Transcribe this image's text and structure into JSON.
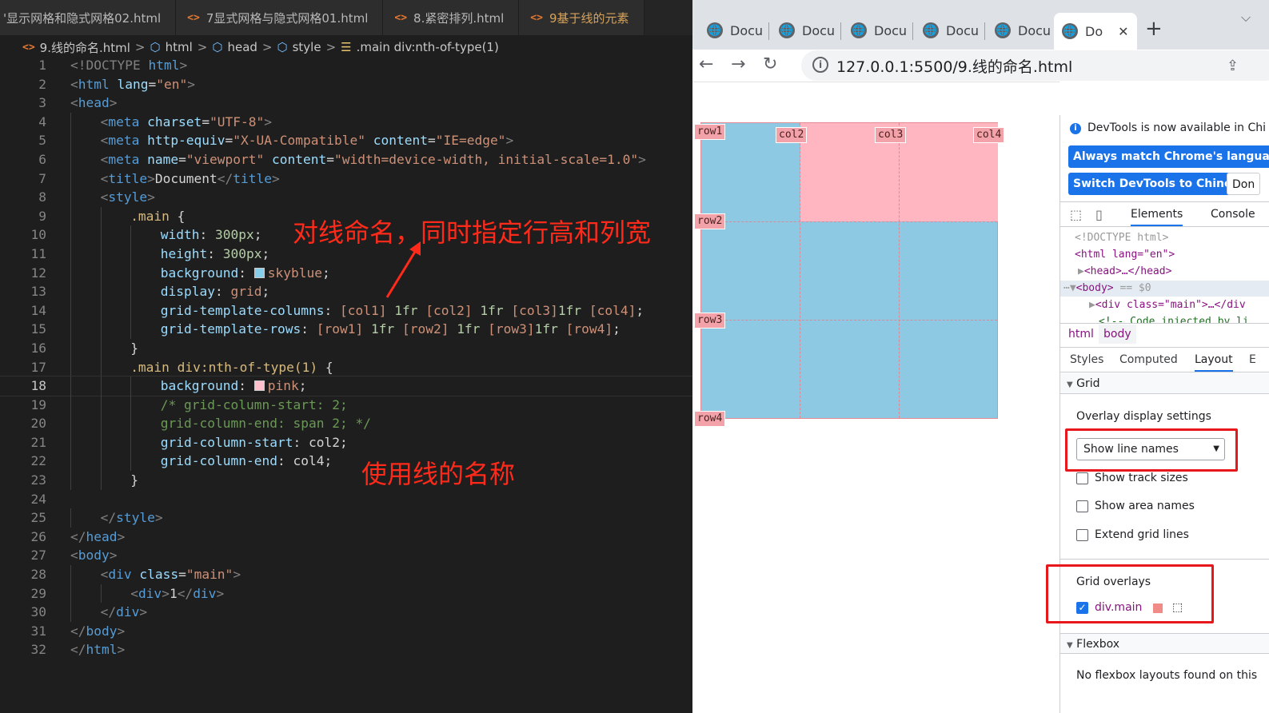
{
  "editor": {
    "tabs": [
      {
        "label": "'显示网格和隐式网格02.html",
        "icon": ""
      },
      {
        "label": "7显式网格与隐式网格01.html",
        "icon": "<>"
      },
      {
        "label": "8.紧密排列.html",
        "icon": "<>"
      },
      {
        "label": "9基于线的元素",
        "icon": "<>"
      }
    ],
    "breadcrumb": {
      "file": "9.线的命名.html",
      "html": "html",
      "head": "head",
      "style": "style",
      "selector": ".main div:nth-of-type(1)"
    },
    "code": {
      "l1": [
        "<!DOCTYPE ",
        "html",
        ">"
      ],
      "l2": [
        "<",
        "html",
        " ",
        "lang",
        "=",
        "\"en\"",
        ">"
      ],
      "l3": [
        "<",
        "head",
        ">"
      ],
      "l4": [
        "<",
        "meta",
        " ",
        "charset",
        "=",
        "\"UTF-8\"",
        ">"
      ],
      "l5": [
        "<",
        "meta",
        " ",
        "http-equiv",
        "=",
        "\"X-UA-Compatible\"",
        " ",
        "content",
        "=",
        "\"IE=edge\"",
        ">"
      ],
      "l6": [
        "<",
        "meta",
        " ",
        "name",
        "=",
        "\"viewport\"",
        " ",
        "content",
        "=",
        "\"width=device-width, initial-scale=1.0\"",
        ">"
      ],
      "l7": [
        "<",
        "title",
        ">",
        "Document",
        "</",
        "title",
        ">"
      ],
      "l8": [
        "<",
        "style",
        ">"
      ],
      "l9": [
        ".main",
        " {"
      ],
      "l10": [
        "width",
        ": ",
        "300px",
        ";"
      ],
      "l11": [
        "height",
        ": ",
        "300px",
        ";"
      ],
      "l12": [
        "background",
        ": ",
        "skyblue",
        ";"
      ],
      "l13": [
        "display",
        ": ",
        "grid",
        ";"
      ],
      "l14": [
        "grid-template-columns",
        ": ",
        "[col1] ",
        "1fr",
        " [col2] ",
        "1fr",
        " [col3]",
        "1fr",
        " [col4]",
        ";"
      ],
      "l15": [
        "grid-template-rows",
        ": ",
        "[row1] ",
        "1fr",
        " [row2] ",
        "1fr",
        " [row3]",
        "1fr",
        " [row4]",
        ";"
      ],
      "l16": [
        "}"
      ],
      "l17": [
        ".main div:nth-of-type(1)",
        " {"
      ],
      "l18": [
        "background",
        ": ",
        "pink",
        ";"
      ],
      "l19": [
        "/* grid-column-start: 2;"
      ],
      "l20": [
        "grid-column-end: span 2; */"
      ],
      "l21": [
        "grid-column-start",
        ": ",
        "col2",
        ";"
      ],
      "l22": [
        "grid-column-end",
        ": ",
        "col4",
        ";"
      ],
      "l23": [
        "}"
      ],
      "l24": [
        ""
      ],
      "l25": [
        "</",
        "style",
        ">"
      ],
      "l26": [
        "</",
        "head",
        ">"
      ],
      "l27": [
        "<",
        "body",
        ">"
      ],
      "l28": [
        "<",
        "div",
        " ",
        "class",
        "=",
        "\"main\"",
        ">"
      ],
      "l29": [
        "<",
        "div",
        ">",
        "1",
        "</",
        "div",
        ">"
      ],
      "l30": [
        "</",
        "div",
        ">"
      ],
      "l31": [
        "</",
        "body",
        ">"
      ],
      "l32": [
        "</",
        "html",
        ">"
      ]
    },
    "swatch_colors": {
      "skyblue": "#87ceeb",
      "pink": "#ffc0cb"
    },
    "annotation_top": "对线命名，同时指定行高和列宽",
    "annotation_bottom": "使用线的名称"
  },
  "browser": {
    "tabs": [
      "Docu",
      "Docu",
      "Docu",
      "Docu",
      "Docu",
      "Do"
    ],
    "new_tab": "+",
    "url": "127.0.0.1:5500/9.线的命名.html",
    "line_names": {
      "row1": "row1",
      "row2": "row2",
      "row3": "row3",
      "row4": "row4",
      "col2": "col2",
      "col3": "col3",
      "col4": "col4"
    }
  },
  "devtools": {
    "banner": "DevTools is now available in Chi",
    "btn_match": "Always match Chrome's language",
    "btn_switch": "Switch DevTools to Chinese",
    "btn_dont": "Don",
    "tab_elements": "Elements",
    "tab_console": "Console",
    "tree": {
      "doctype": "<!DOCTYPE html>",
      "html_open": "<html lang=\"en\">",
      "head": "<head>…</head>",
      "body_open": "<body>",
      "body_suffix": " == $0",
      "div": "<div class=\"main\">…</div",
      "comment": "<!-- Code injected by li"
    },
    "crumbs": {
      "html": "html",
      "body": "body"
    },
    "subtabs": {
      "styles": "Styles",
      "computed": "Computed",
      "layout": "Layout",
      "more": "E"
    },
    "grid_section": "Grid",
    "overlay_title": "Overlay display settings",
    "select_value": "Show line names",
    "show_track_sizes": "Show track sizes",
    "show_area_names": "Show area names",
    "extend_grid_lines": "Extend grid lines",
    "grid_overlays_title": "Grid overlays",
    "overlay_item": "div.main",
    "flexbox_section": "Flexbox",
    "flexbox_empty": "No flexbox layouts found on this"
  }
}
